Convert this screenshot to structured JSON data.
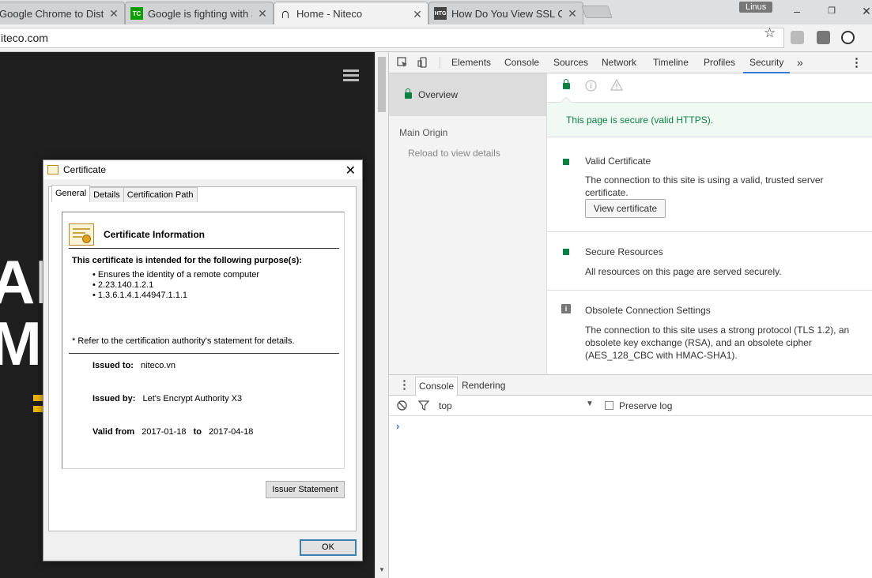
{
  "browser": {
    "tabs": [
      {
        "title": "Google Chrome to Distrust",
        "favicon": "google-icon",
        "active": false
      },
      {
        "title": "Google is fighting with Syr",
        "favicon": "techcrunch-icon",
        "favicon_text": "TC",
        "active": false
      },
      {
        "title": "Home - Niteco",
        "favicon": "niteco-icon",
        "favicon_text": "∩",
        "active": true
      },
      {
        "title": "How Do You View SSL Ce",
        "favicon": "htg-icon",
        "favicon_text": "HTG",
        "active": false
      }
    ],
    "profile_name": "Linus",
    "url": "iteco.com",
    "colors": {
      "tc_green": "#0a9e01",
      "htg_dark": "#444444"
    }
  },
  "certificate_dialog": {
    "title": "Certificate",
    "tabs": [
      "General",
      "Details",
      "Certification Path"
    ],
    "active_tab": "General",
    "info_title": "Certificate Information",
    "purpose_heading": "This certificate is intended for the following purpose(s):",
    "purposes": [
      "Ensures the identity of a remote computer",
      "2.23.140.1.2.1",
      "1.3.6.1.4.1.44947.1.1.1"
    ],
    "refer_note": "* Refer to the certification authority's statement for details.",
    "issued_to_label": "Issued to:",
    "issued_to": "niteco.vn",
    "issued_by_label": "Issued by:",
    "issued_by": "Let's Encrypt Authority X3",
    "valid_from_label": "Valid from",
    "valid_from": "2017-01-18",
    "valid_to_label": "to",
    "valid_to": "2017-04-18",
    "issuer_statement_label": "Issuer Statement",
    "ok_label": "OK"
  },
  "devtools": {
    "tabs": [
      "Elements",
      "Console",
      "Sources",
      "Network",
      "Timeline",
      "Profiles",
      "Security"
    ],
    "active_tab": "Security",
    "more_tabs": "»",
    "security": {
      "overview_label": "Overview",
      "main_origin_label": "Main Origin",
      "reload_hint": "Reload to view details",
      "banner": "This page is secure (valid HTTPS).",
      "sections": [
        {
          "title": "Valid Certificate",
          "description": "The connection to this site is using a valid, trusted server certificate.",
          "button": "View certificate",
          "status": "secure"
        },
        {
          "title": "Secure Resources",
          "description": "All resources on this page are served securely.",
          "status": "secure"
        },
        {
          "title": "Obsolete Connection Settings",
          "description": "The connection to this site uses a strong protocol (TLS 1.2), an obsolete key exchange (RSA), and an obsolete cipher (AES_128_CBC with HMAC-SHA1).",
          "status": "info"
        }
      ],
      "colors": {
        "secure_green": "#0b8043",
        "banner_bg": "#f0faf3"
      }
    },
    "drawer": {
      "tabs": [
        "Console",
        "Rendering"
      ],
      "active_tab": "Console",
      "context": "top",
      "preserve_log_label": "Preserve log",
      "preserve_log_checked": false,
      "prompt": "›"
    }
  },
  "page": {
    "big_text_1": "AM",
    "big_text_2": "MI",
    "colors": {
      "background": "#1f1f1f",
      "accent_yellow": "#f2b705"
    }
  }
}
